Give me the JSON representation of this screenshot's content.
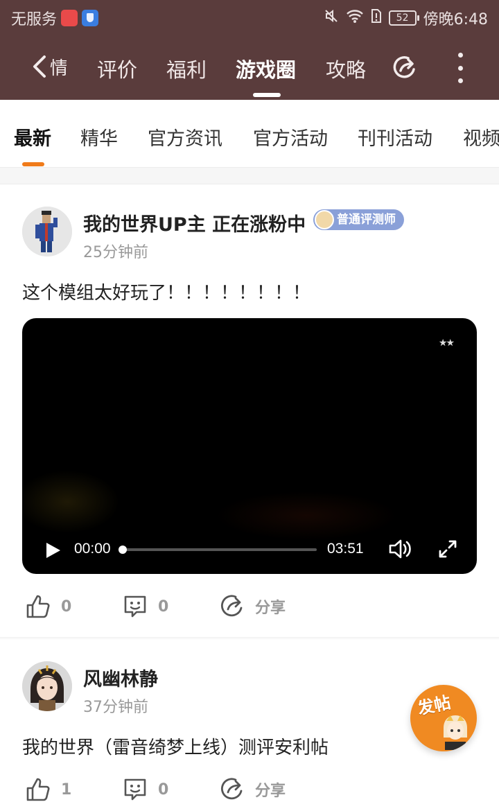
{
  "status_bar": {
    "carrier": "无服务",
    "time": "傍晚6:48",
    "battery": "52"
  },
  "nav": {
    "back_fragment": "情",
    "tabs": [
      {
        "label": "评价",
        "active": false
      },
      {
        "label": "福利",
        "active": false
      },
      {
        "label": "游戏圈",
        "active": true
      },
      {
        "label": "攻略",
        "active": false
      }
    ]
  },
  "sub_tabs": [
    {
      "label": "最新",
      "active": true
    },
    {
      "label": "精华",
      "active": false
    },
    {
      "label": "官方资讯",
      "active": false
    },
    {
      "label": "官方活动",
      "active": false
    },
    {
      "label": "刊刊活动",
      "active": false
    },
    {
      "label": "视频",
      "active": false
    }
  ],
  "posts": [
    {
      "author": "我的世界UP主 正在涨粉中",
      "badge": "普通评测师",
      "time": "25分钟前",
      "text": "这个模组太好玩了！！！！！！！！",
      "video": {
        "current_time": "00:00",
        "duration": "03:51",
        "progress": 0
      },
      "likes": "0",
      "comments": "0",
      "share_label": "分享"
    },
    {
      "author": "风幽林静",
      "time": "37分钟前",
      "text": "我的世界（雷音绮梦上线）测评安利帖",
      "likes": "1",
      "comments": "0",
      "share_label": "分享"
    }
  ],
  "fab": {
    "label": "发帖"
  },
  "colors": {
    "header_bg": "#5a3c3c",
    "accent": "#f07b1a",
    "badge_bg": "#8aa0d8"
  }
}
